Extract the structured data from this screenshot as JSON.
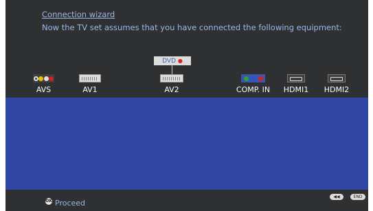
{
  "header": {
    "title": "Connection wizard",
    "subtitle": "Now the TV set assumes that you have connected the following equipment:"
  },
  "device": {
    "label": "DVD",
    "dot_color": "#e02020"
  },
  "ports": [
    {
      "label": "AVS",
      "type": "rca-svideo",
      "icon": "avs-connector-icon"
    },
    {
      "label": "AV1",
      "type": "scart",
      "icon": "scart-connector-icon"
    },
    {
      "label": "AV2",
      "type": "scart",
      "icon": "scart-connector-icon"
    },
    {
      "label": "COMP. IN",
      "type": "component",
      "icon": "component-connector-icon"
    },
    {
      "label": "HDMI1",
      "type": "hdmi",
      "icon": "hdmi-connector-icon"
    },
    {
      "label": "HDMI2",
      "type": "hdmi",
      "icon": "hdmi-connector-icon"
    }
  ],
  "footer": {
    "ok_icon_text": "OK",
    "proceed_label": "Proceed",
    "rewind_icon_text": "◀◀",
    "end_label": "END"
  },
  "colors": {
    "background": "#2e3032",
    "panel_blue": "#3046a2",
    "text_accent": "#9db8e8"
  }
}
